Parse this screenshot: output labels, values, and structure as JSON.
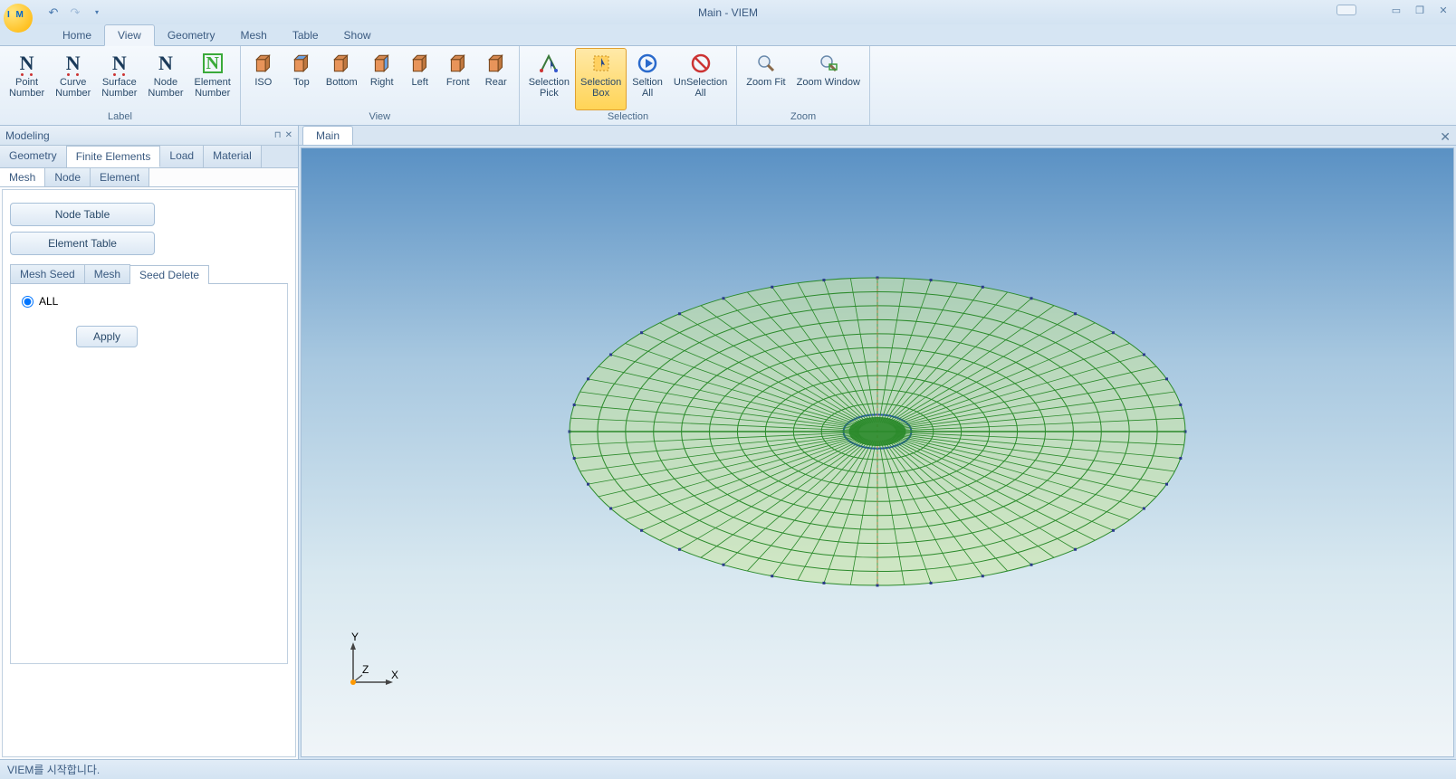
{
  "title": "Main - VIEM",
  "menutabs": [
    "Home",
    "View",
    "Geometry",
    "Mesh",
    "Table",
    "Show"
  ],
  "active_menutab": 1,
  "ribbon": {
    "groups": [
      {
        "label": "Label",
        "buttons": [
          "Point\nNumber",
          "Curve\nNumber",
          "Surface\nNumber",
          "Node\nNumber",
          "Element\nNumber"
        ]
      },
      {
        "label": "View",
        "buttons": [
          "ISO",
          "Top",
          "Bottom",
          "Right",
          "Left",
          "Front",
          "Rear"
        ]
      },
      {
        "label": "Selection",
        "buttons": [
          "Selection\nPick",
          "Selection\nBox",
          "Seltion\nAll",
          "UnSelection\nAll"
        ],
        "active_index": 1
      },
      {
        "label": "Zoom",
        "buttons": [
          "Zoom Fit",
          "Zoom Window"
        ]
      }
    ]
  },
  "side_panel": {
    "title": "Modeling",
    "tabs1": [
      "Geometry",
      "Finite Elements",
      "Load",
      "Material"
    ],
    "active_tab1": 1,
    "tabs2": [
      "Mesh",
      "Node",
      "Element"
    ],
    "active_tab2": 0,
    "buttons": [
      "Node Table",
      "Element Table"
    ],
    "tabs3": [
      "Mesh Seed",
      "Mesh",
      "Seed Delete"
    ],
    "active_tab3": 2,
    "radio_label": "ALL",
    "apply_label": "Apply"
  },
  "viewport": {
    "tab_label": "Main",
    "axis": {
      "x": "X",
      "y": "Y",
      "z": "Z"
    }
  },
  "statusbar": "VIEM를 시작합니다.",
  "mesh": {
    "radial_lines": 72,
    "rings": 11
  }
}
